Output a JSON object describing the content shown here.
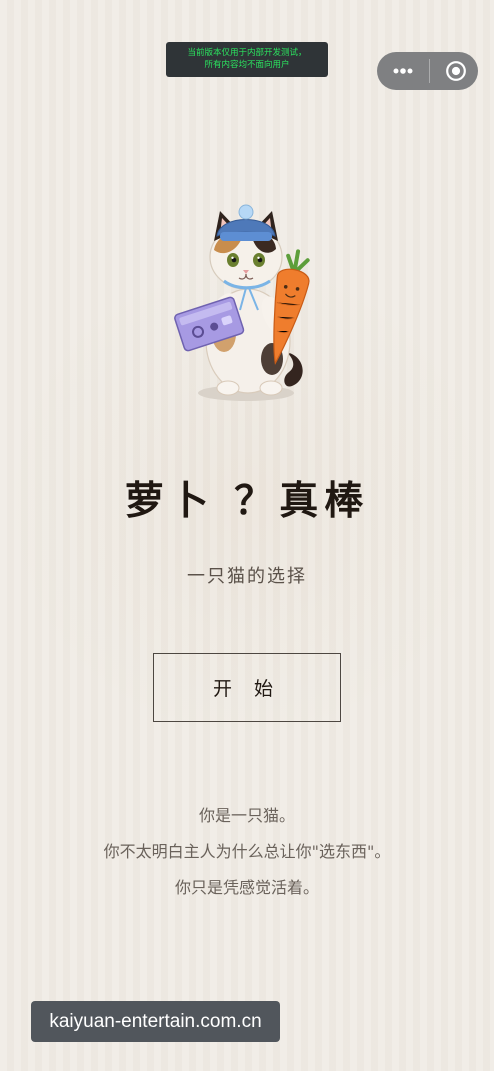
{
  "dev_notice": {
    "line1": "当前版本仅用于内部开发测试，",
    "line2": "所有内容均不面向用户"
  },
  "capsule": {
    "menu_icon": "more-dots-icon",
    "close_icon": "target-icon"
  },
  "hero": {
    "image_icon": "cat-illustration"
  },
  "title": "萝卜 ？真棒",
  "subtitle": "一只猫的选择",
  "start_button": "开 始",
  "story_lines": [
    "你是一只猫。",
    "你不太明白主人为什么总让你\"选东西\"。",
    "你只是凭感觉活着。"
  ],
  "watermark": "kaiyuan-entertain.com.cn",
  "colors": {
    "background": "#efebe4",
    "title": "#201812",
    "dev_banner": "#2f3437",
    "dev_text": "#2be35f",
    "capsule": "#7f8082"
  }
}
